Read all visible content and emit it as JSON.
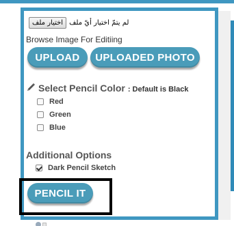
{
  "file_input": {
    "button_label": "اختيار ملف",
    "status_text": "لم يتمّ اختيار أيّ ملف"
  },
  "browse_label": "Browse Image For Editiing",
  "buttons": {
    "upload": "UPLOAD",
    "uploaded_photo": "UPLOADED PHOTO",
    "pencil_it": "PENCIL IT"
  },
  "pencil_color": {
    "heading": "Select Pencil Color",
    "subheading": ": Default is Black",
    "options": [
      {
        "label": "Red",
        "checked": false
      },
      {
        "label": "Green",
        "checked": false
      },
      {
        "label": "Blue",
        "checked": false
      }
    ]
  },
  "additional": {
    "heading": "Additional Options",
    "options": [
      {
        "label": "Dark Pencil Sketch",
        "checked": true
      }
    ]
  },
  "colors": {
    "frame_border": "#3f97c1",
    "button_bg": "#4a9cb9",
    "button_text": "#ffffff",
    "highlight": "#000000"
  },
  "icons": {
    "pencil": "pencil-icon"
  }
}
